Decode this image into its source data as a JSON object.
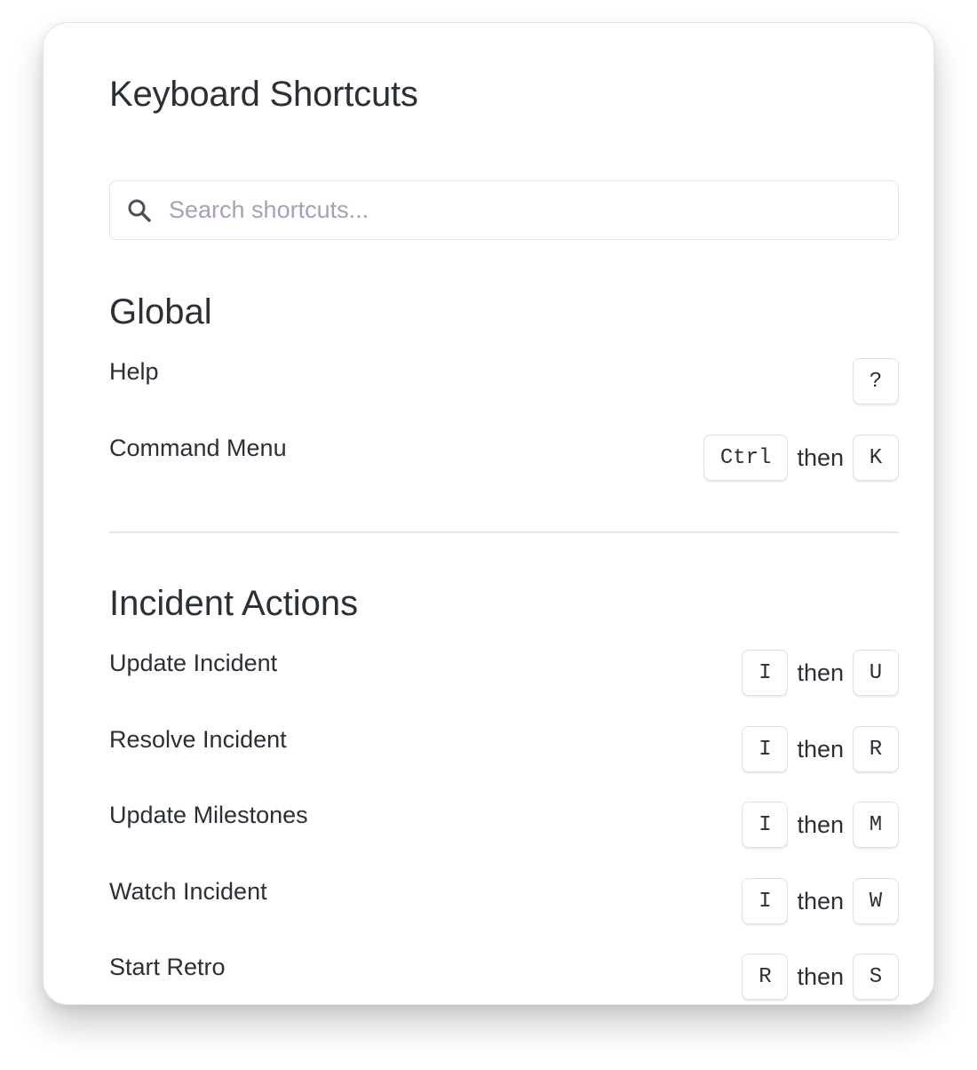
{
  "dialog": {
    "title": "Keyboard Shortcuts"
  },
  "search": {
    "placeholder": "Search shortcuts...",
    "icon": "search-icon"
  },
  "sections": [
    {
      "heading": "Global",
      "shortcuts": [
        {
          "label": "Help",
          "keys": [
            "?"
          ]
        },
        {
          "label": "Command Menu",
          "keys": [
            "Ctrl",
            "K"
          ],
          "joiner": "then"
        }
      ]
    },
    {
      "heading": "Incident Actions",
      "shortcuts": [
        {
          "label": "Update Incident",
          "keys": [
            "I",
            "U"
          ],
          "joiner": "then"
        },
        {
          "label": "Resolve Incident",
          "keys": [
            "I",
            "R"
          ],
          "joiner": "then"
        },
        {
          "label": "Update Milestones",
          "keys": [
            "I",
            "M"
          ],
          "joiner": "then"
        },
        {
          "label": "Watch Incident",
          "keys": [
            "I",
            "W"
          ],
          "joiner": "then"
        },
        {
          "label": "Start Retro",
          "keys": [
            "R",
            "S"
          ],
          "joiner": "then"
        }
      ]
    }
  ]
}
